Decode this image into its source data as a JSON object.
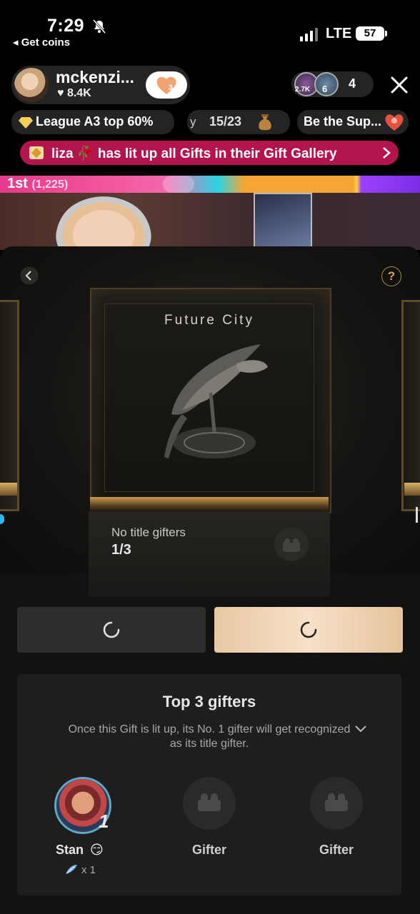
{
  "status_bar": {
    "time": "7:29",
    "back_app": "◂ Get coins",
    "network": "LTE",
    "battery": "57"
  },
  "host": {
    "name": "mckenzi...",
    "likes": "♥ 8.4K",
    "follow_badge": "3"
  },
  "viewers": {
    "avatar1_badge": "2.7K",
    "avatar2_badge": "6",
    "count": "4"
  },
  "chips": {
    "league": "League A3 top 60%",
    "rank_prefix": "y",
    "rank": "15/23",
    "super": "Be the Sup..."
  },
  "banner": {
    "text": "liza 🥀 has lit up all Gifts in their Gift Gallery"
  },
  "rank_bar": {
    "label": "1st",
    "score": "(1,225)"
  },
  "gift": {
    "name": "Future City",
    "info_label": "No title gifters",
    "progress": "1/3"
  },
  "top_gifters": {
    "title": "Top 3 gifters",
    "description": "Once this Gift is lit up, its No. 1 gifter will get recognized as its title gifter.",
    "items": [
      {
        "rank": "1",
        "name": "Stan",
        "emoji": "😏",
        "count": "x 1"
      },
      {
        "name": "Gifter"
      },
      {
        "name": "Gifter"
      }
    ]
  },
  "colors": {
    "banner": "#b3144d",
    "primary_button": "#f0d4b4",
    "accent_gold": "#cfa962"
  },
  "icons": [
    "bell-muted-icon",
    "signal-icon",
    "close-icon",
    "heart-icon",
    "diamond-icon",
    "chevron-right-icon",
    "back-icon",
    "help-icon",
    "armchair-icon",
    "spinner-icon",
    "chevron-down-icon",
    "gift-icon"
  ]
}
